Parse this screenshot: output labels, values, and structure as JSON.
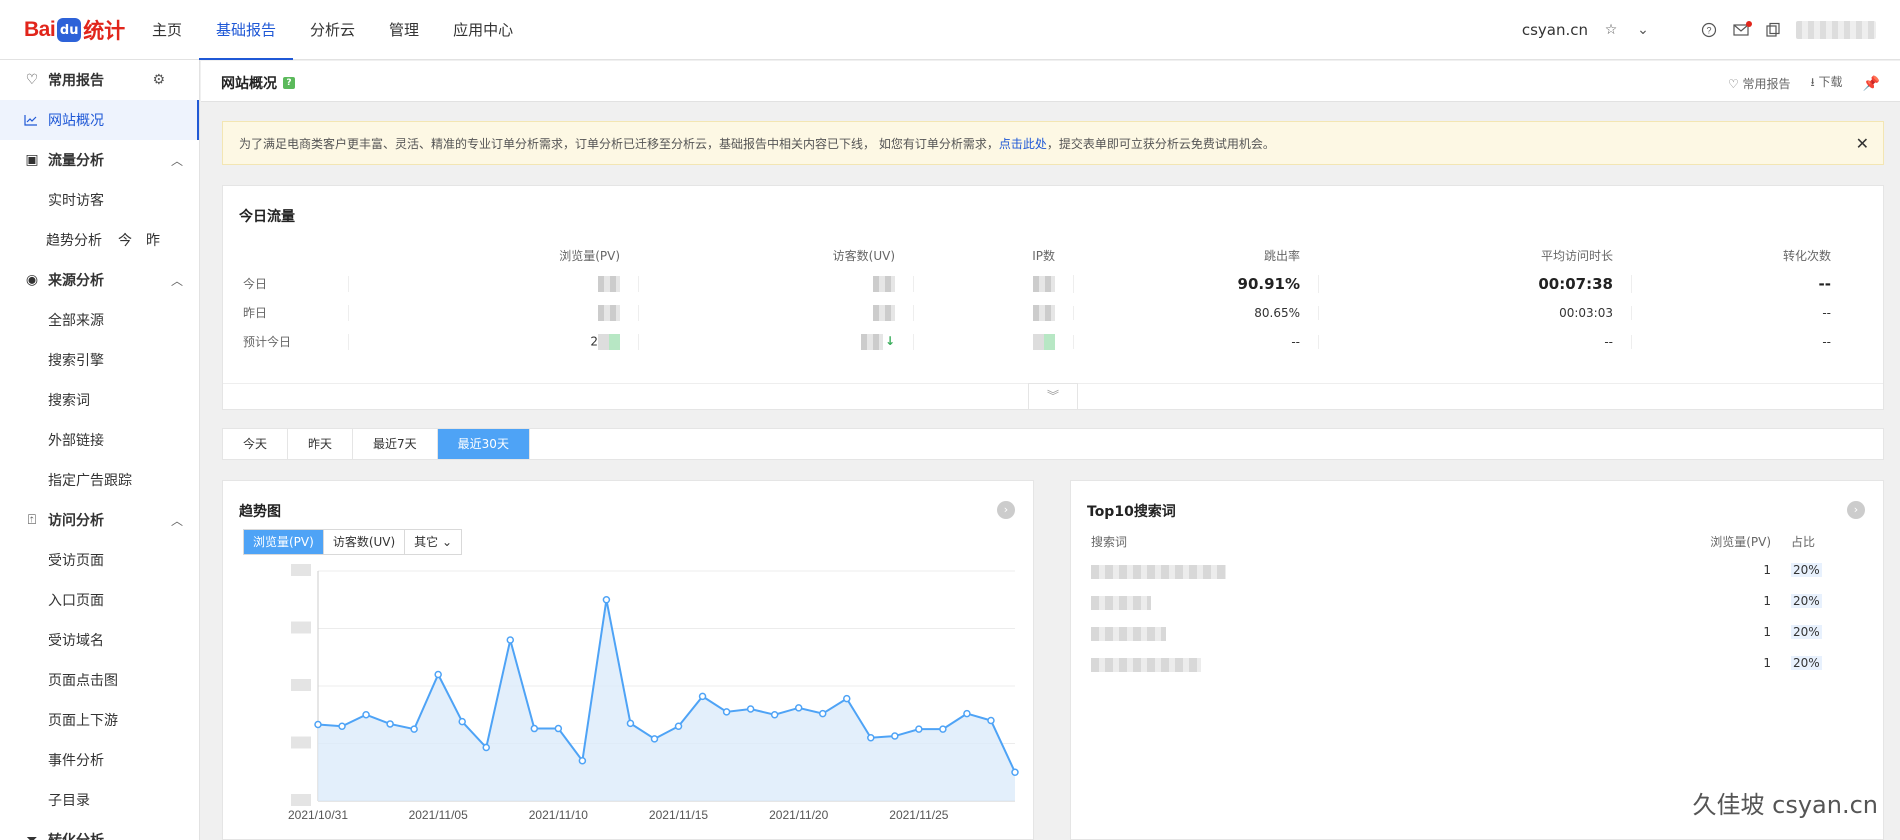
{
  "logo": {
    "bai": "Bai",
    "paw": "du",
    "tj": "统计"
  },
  "topnav": [
    {
      "label": "主页",
      "active": false
    },
    {
      "label": "基础报告",
      "active": true
    },
    {
      "label": "分析云",
      "active": false
    },
    {
      "label": "管理",
      "active": false
    },
    {
      "label": "应用中心",
      "active": false
    }
  ],
  "topright": {
    "site": "csyan.cn"
  },
  "sidebar": {
    "common": "常用报告",
    "overview": "网站概况",
    "flow": "流量分析",
    "realtime": "实时访客",
    "trend": "趋势分析",
    "trend_today": "今",
    "trend_yest": "昨",
    "source": "来源分析",
    "all_source": "全部来源",
    "search_engine": "搜索引擎",
    "search_word": "搜索词",
    "ext_link": "外部链接",
    "ad_track": "指定广告跟踪",
    "visit": "访问分析",
    "visited_page": "受访页面",
    "entry_page": "入口页面",
    "visited_domain": "受访域名",
    "page_click": "页面点击图",
    "page_updown": "页面上下游",
    "event": "事件分析",
    "subdir": "子目录",
    "convert": "转化分析"
  },
  "pagehead": {
    "title": "网站概况",
    "help": "?",
    "fav": "常用报告",
    "download": "下载"
  },
  "notice": {
    "text1": "为了满足电商类客户更丰富、灵活、精准的专业订单分析需求，订单分析已迁移至分析云，基础报告中相关内容已下线， 如您有订单分析需求，",
    "link": "点击此处",
    "text2": "，提交表单即可立获分析云免费试用机会。"
  },
  "today": {
    "title": "今日流量",
    "headers": [
      "浏览量(PV)",
      "访客数(UV)",
      "IP数",
      "跳出率",
      "平均访问时长",
      "转化次数"
    ],
    "rows": [
      {
        "label": "今日",
        "bounce": "90.91%",
        "duration": "00:07:38",
        "conv": "--"
      },
      {
        "label": "昨日",
        "bounce": "80.65%",
        "duration": "00:03:03",
        "conv": "--"
      },
      {
        "label": "预计今日",
        "pv_prefix": "2",
        "bounce": "--",
        "duration": "--",
        "conv": "--"
      }
    ]
  },
  "ranges": [
    {
      "label": "今天",
      "active": false
    },
    {
      "label": "昨天",
      "active": false
    },
    {
      "label": "最近7天",
      "active": false
    },
    {
      "label": "最近30天",
      "active": true
    }
  ],
  "trend": {
    "title": "趋势图",
    "tabs": [
      {
        "label": "浏览量(PV)",
        "active": true
      },
      {
        "label": "访客数(UV)",
        "active": false
      },
      {
        "label": "其它",
        "active": false
      }
    ]
  },
  "chart_data": {
    "type": "area",
    "title": "趋势图",
    "series": [
      {
        "values": [
          13.3,
          13.0,
          15.0,
          13.4,
          12.5,
          22.0,
          13.8,
          9.3,
          28.0,
          12.6,
          12.6,
          7.0,
          35.0,
          13.5,
          10.8,
          13.0,
          18.2,
          15.5,
          16.0,
          15.0,
          16.2,
          15.2,
          17.8,
          11.0,
          11.3,
          12.5,
          12.5,
          15.2,
          14.0,
          5.0
        ]
      }
    ],
    "x": [
      "2021/10/31",
      "2021/11/01",
      "2021/11/02",
      "2021/11/03",
      "2021/11/04",
      "2021/11/05",
      "2021/11/06",
      "2021/11/07",
      "2021/11/08",
      "2021/11/09",
      "2021/11/10",
      "2021/11/11",
      "2021/11/12",
      "2021/11/13",
      "2021/11/14",
      "2021/11/15",
      "2021/11/16",
      "2021/11/17",
      "2021/11/18",
      "2021/11/19",
      "2021/11/20",
      "2021/11/21",
      "2021/11/22",
      "2021/11/23",
      "2021/11/24",
      "2021/11/25",
      "2021/11/26",
      "2021/11/27",
      "2021/11/28",
      "2021/11/29"
    ],
    "xtick_labels": [
      "2021/10/31",
      "2021/11/05",
      "2021/11/10",
      "2021/11/15",
      "2021/11/20",
      "2021/11/25"
    ],
    "ylim": [
      0,
      40
    ],
    "grid": true,
    "colors": {
      "line": "#4ea3f6",
      "fill": "#dcebfa"
    }
  },
  "top10": {
    "title": "Top10搜索词",
    "headers": {
      "kw": "搜索词",
      "pv": "浏览量(PV)",
      "pct": "占比"
    },
    "rows": [
      {
        "pv": "1",
        "pct": "20%"
      },
      {
        "pv": "1",
        "pct": "20%"
      },
      {
        "pv": "1",
        "pct": "20%"
      },
      {
        "pv": "1",
        "pct": "20%"
      }
    ]
  },
  "watermark": "久佳坡 csyan.cn"
}
